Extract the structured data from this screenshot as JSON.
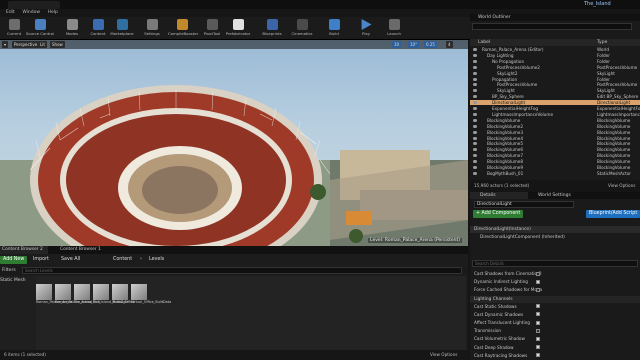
{
  "titlebar": {
    "project": "The_Island"
  },
  "menu": [
    "Edit",
    "Window",
    "Help"
  ],
  "toolbar": [
    {
      "label": "Current",
      "icon": "save-icon"
    },
    {
      "label": "Source Control",
      "icon": "source-control-icon"
    },
    {
      "label": "Modes",
      "icon": "modes-icon"
    },
    {
      "label": "Content",
      "icon": "content-icon"
    },
    {
      "label": "Marketplace",
      "icon": "marketplace-icon"
    },
    {
      "label": "Settings",
      "icon": "settings-icon"
    },
    {
      "label": "CompileBooster",
      "icon": "compile-booster-icon"
    },
    {
      "label": "PivotTool",
      "icon": "pivot-tool-icon"
    },
    {
      "label": "Prefabricator",
      "icon": "prefabricator-icon"
    },
    {
      "label": "Blueprints",
      "icon": "blueprints-icon"
    },
    {
      "label": "Cinematics",
      "icon": "cinematics-icon"
    },
    {
      "label": "Build",
      "icon": "build-icon"
    },
    {
      "label": "Play",
      "icon": "play-icon"
    },
    {
      "label": "Launch",
      "icon": "launch-icon"
    }
  ],
  "viewport": {
    "perspective": "Perspective",
    "lit": "Lit",
    "show": "Show",
    "snap_value": "10",
    "snap_angle": "10°",
    "scale": "0.25",
    "level_prefix": "Level:",
    "level_name": "Roman_Palace_Arena (Persistent)"
  },
  "outliner": {
    "title": "World Outliner",
    "col_label": "Label",
    "col_type": "Type",
    "rows": [
      {
        "label": "Roman_Palace_Arena (Editor)",
        "type": "World",
        "indent": 0
      },
      {
        "label": "Day Lighting",
        "type": "Folder",
        "indent": 1
      },
      {
        "label": "No Propagation",
        "type": "Folder",
        "indent": 2
      },
      {
        "label": "PostProcessVolume2",
        "type": "PostProcessVolume",
        "indent": 3
      },
      {
        "label": "SkyLight2",
        "type": "SkyLight",
        "indent": 3
      },
      {
        "label": "Propagation",
        "type": "Folder",
        "indent": 2
      },
      {
        "label": "PostProcessVolume",
        "type": "PostProcessVolume",
        "indent": 3
      },
      {
        "label": "SkyLight",
        "type": "SkyLight",
        "indent": 3
      },
      {
        "label": "BP_Sky_Sphere",
        "type": "Edit BP_Sky_Sphere",
        "indent": 2
      },
      {
        "label": "DirectionalLight",
        "type": "DirectionalLight",
        "indent": 2,
        "selected": true
      },
      {
        "label": "ExponentialHeightFog",
        "type": "ExponentialHeightFog",
        "indent": 2
      },
      {
        "label": "LightmassImportanceVolume",
        "type": "LightmassImportanceVolume",
        "indent": 2
      },
      {
        "label": "BlockingVolume",
        "type": "BlockingVolume",
        "indent": 1
      },
      {
        "label": "BlockingVolume2",
        "type": "BlockingVolume",
        "indent": 1
      },
      {
        "label": "BlockingVolume3",
        "type": "BlockingVolume",
        "indent": 1
      },
      {
        "label": "BlockingVolume4",
        "type": "BlockingVolume",
        "indent": 1
      },
      {
        "label": "BlockingVolume5",
        "type": "BlockingVolume",
        "indent": 1
      },
      {
        "label": "BlockingVolume6",
        "type": "BlockingVolume",
        "indent": 1
      },
      {
        "label": "BlockingVolume7",
        "type": "BlockingVolume",
        "indent": 1
      },
      {
        "label": "BlockingVolume8",
        "type": "BlockingVolume",
        "indent": 1
      },
      {
        "label": "BlockingVolume9",
        "type": "BlockingVolume",
        "indent": 1
      },
      {
        "label": "BogMythBush_01",
        "type": "StaticMeshActor",
        "indent": 1
      }
    ],
    "footer": "15,960 actors (1 selected)",
    "view_options": "View Options"
  },
  "details": {
    "tab_details": "Details",
    "tab_world_settings": "World Settings",
    "actor_name": "DirectionalLight",
    "add_component": "+ Add Component",
    "blueprint_button": "Blueprint/Add Script",
    "instance_label": "DirectionalLight(Instance)",
    "component_label": "DirectionalLightComponent (Inherited)",
    "search_placeholder": "Search Details",
    "section_lighting": "Lighting Channels",
    "properties": [
      {
        "label": "Cast Shadows from Cinematic O",
        "checked": false
      },
      {
        "label": "Dynamic Indirect Lighting",
        "checked": true
      },
      {
        "label": "Force Cached Shadows for Mova",
        "checked": false
      },
      {
        "label": "Cast Static Shadows",
        "checked": true
      },
      {
        "label": "Cast Dynamic Shadows",
        "checked": true
      },
      {
        "label": "Affect Translucent Lighting",
        "checked": true
      },
      {
        "label": "Transmission",
        "checked": false
      },
      {
        "label": "Cast Volumetric Shadow",
        "checked": true
      },
      {
        "label": "Cast Deep Shadow",
        "checked": true
      },
      {
        "label": "Cast Raytracing Shadows",
        "checked": true
      }
    ]
  },
  "content_browser": {
    "tab1": "Content Browser 2",
    "tab2": "Content Browser 1",
    "add_new": "Add New",
    "import": "Import",
    "save_all": "Save All",
    "path_content": "Content",
    "path_levels": "Levels",
    "filters": "Filters",
    "search_placeholder": "Search Levels",
    "filter_tag": "Static Mesh",
    "assets": [
      {
        "name": "Roman_Palace_Arena"
      },
      {
        "name": "Roman_Palace_Arena_Built"
      },
      {
        "name": "The_Island"
      },
      {
        "name": "The_Island_BuiltData"
      },
      {
        "name": "Virtual_Office"
      },
      {
        "name": "Virtual_Office_BuiltData"
      }
    ],
    "footer": "6 items (1 selected)",
    "view_options": "View Options"
  }
}
